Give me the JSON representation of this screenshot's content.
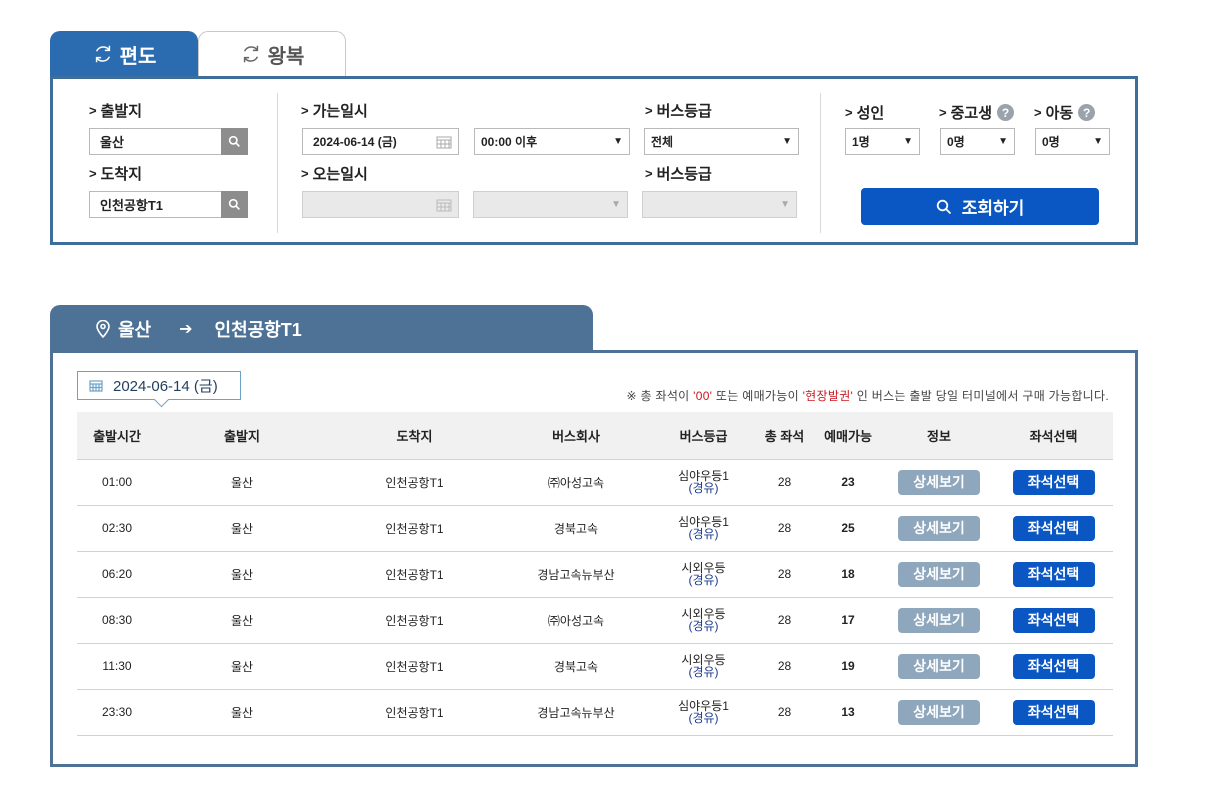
{
  "tabs": {
    "oneway": "편도",
    "roundtrip": "왕복"
  },
  "search": {
    "departure_label": "출발지",
    "departure_value": "울산",
    "arrival_label": "도착지",
    "arrival_value": "인천공항T1",
    "go_date_label": "가는일시",
    "go_date_value": "2024-06-14 (금)",
    "go_time_value": "00:00 이후",
    "return_date_label": "오는일시",
    "bus_grade_label": "버스등급",
    "bus_grade_value": "전체",
    "bus_grade_label2": "버스등급",
    "adult_label": "성인",
    "adult_value": "1명",
    "student_label": "중고생",
    "student_value": "0명",
    "child_label": "아동",
    "child_value": "0명",
    "help_mark": "?",
    "lookup_button": "조회하기"
  },
  "route": {
    "from": "울산",
    "to": "인천공항T1",
    "arrow": "➔"
  },
  "result": {
    "date": "2024-06-14 (금)",
    "notice_prefix": "※ 총 좌석이 ",
    "notice_zero": "'00'",
    "notice_mid": " 또는 예매가능이 ",
    "notice_onsite": "'현장발권'",
    "notice_suffix": " 인 버스는 출발 당일 터미널에서 구매 가능합니다.",
    "columns": [
      "출발시간",
      "출발지",
      "도착지",
      "버스회사",
      "버스등급",
      "총 좌석",
      "예매가능",
      "정보",
      "좌석선택"
    ],
    "rows": [
      {
        "time": "01:00",
        "from": "울산",
        "to": "인천공항T1",
        "company": "㈜아성고속",
        "grade": "심야우등1",
        "via": "(경유)",
        "total": "28",
        "avail": "23"
      },
      {
        "time": "02:30",
        "from": "울산",
        "to": "인천공항T1",
        "company": "경북고속",
        "grade": "심야우등1",
        "via": "(경유)",
        "total": "28",
        "avail": "25"
      },
      {
        "time": "06:20",
        "from": "울산",
        "to": "인천공항T1",
        "company": "경남고속뉴부산",
        "grade": "시외우등",
        "via": "(경유)",
        "total": "28",
        "avail": "18"
      },
      {
        "time": "08:30",
        "from": "울산",
        "to": "인천공항T1",
        "company": "㈜아성고속",
        "grade": "시외우등",
        "via": "(경유)",
        "total": "28",
        "avail": "17"
      },
      {
        "time": "11:30",
        "from": "울산",
        "to": "인천공항T1",
        "company": "경북고속",
        "grade": "시외우등",
        "via": "(경유)",
        "total": "28",
        "avail": "19"
      },
      {
        "time": "23:30",
        "from": "울산",
        "to": "인천공항T1",
        "company": "경남고속뉴부산",
        "grade": "심야우등1",
        "via": "(경유)",
        "total": "28",
        "avail": "13"
      }
    ],
    "detail_button": "상세보기",
    "seat_button": "좌석선택"
  },
  "colors": {
    "primary": "#0a56c2",
    "tab_active": "#2b6cb0",
    "route_header": "#4d7296",
    "detail_btn": "#8ea7bd"
  }
}
